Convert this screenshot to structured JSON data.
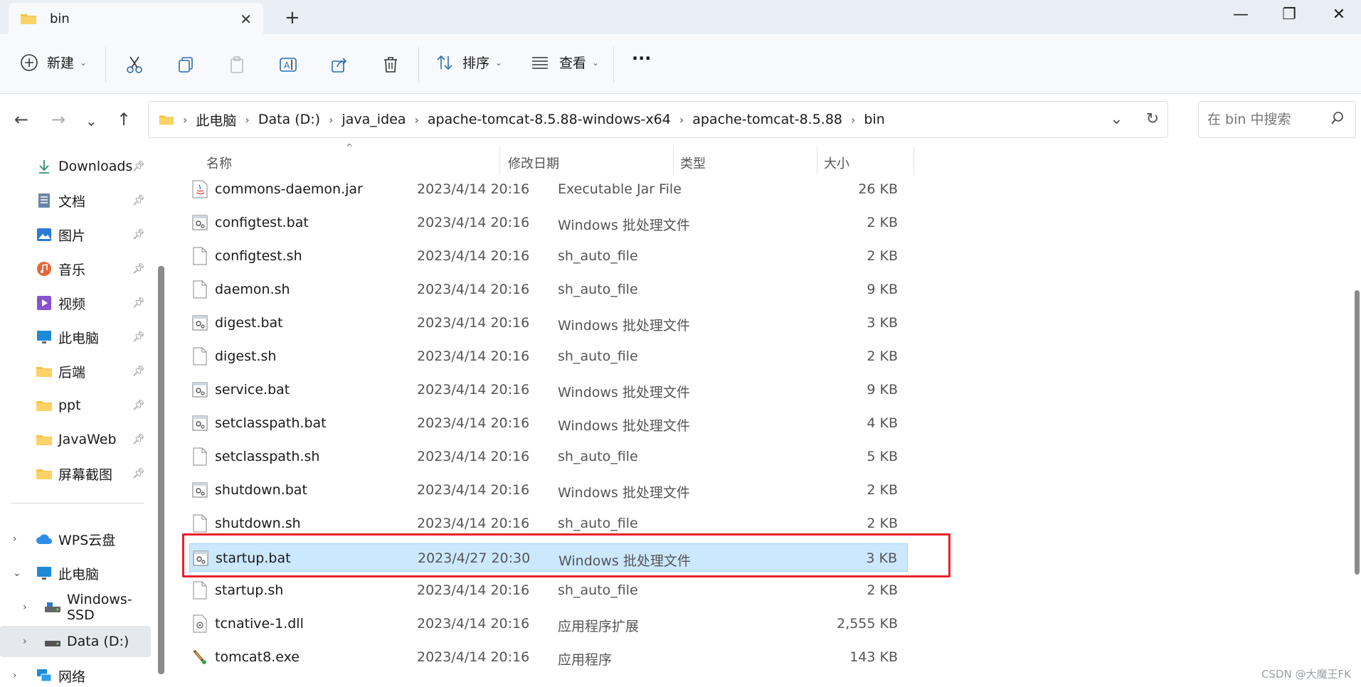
{
  "window": {
    "tab_title": "bin",
    "new_tab": "+",
    "minimize": "—",
    "maximize": "❐",
    "close": "✕",
    "tab_close": "✕"
  },
  "toolbar": {
    "new_label": "新建",
    "sort_label": "排序",
    "view_label": "查看",
    "more": "···",
    "icons": [
      "cut-icon",
      "copy-icon",
      "paste-icon",
      "rename-icon",
      "share-icon",
      "delete-icon"
    ]
  },
  "address": {
    "breadcrumbs": [
      "此电脑",
      "Data (D:)",
      "java_idea",
      "apache-tomcat-8.5.88-windows-x64",
      "apache-tomcat-8.5.88",
      "bin"
    ],
    "search_placeholder": "在 bin 中搜索"
  },
  "sidebar": {
    "items": [
      {
        "label": "Downloads",
        "icon": "download-icon",
        "pinned": true
      },
      {
        "label": "文档",
        "icon": "document-icon",
        "pinned": true
      },
      {
        "label": "图片",
        "icon": "pictures-icon",
        "pinned": true
      },
      {
        "label": "音乐",
        "icon": "music-icon",
        "pinned": true
      },
      {
        "label": "视频",
        "icon": "video-icon",
        "pinned": true
      },
      {
        "label": "此电脑",
        "icon": "computer-icon",
        "pinned": true
      },
      {
        "label": "后端",
        "icon": "folder-icon",
        "pinned": true
      },
      {
        "label": "ppt",
        "icon": "folder-icon",
        "pinned": true
      },
      {
        "label": "JavaWeb",
        "icon": "folder-icon",
        "pinned": true
      },
      {
        "label": "屏幕截图",
        "icon": "folder-icon",
        "pinned": true
      }
    ],
    "tree": [
      {
        "label": "WPS云盘",
        "icon": "cloud-icon",
        "expander": "›"
      },
      {
        "label": "此电脑",
        "icon": "computer-icon",
        "expander": "⌄"
      },
      {
        "label": "Windows-SSD",
        "icon": "drive-icon",
        "expander": "›"
      },
      {
        "label": "Data (D:)",
        "icon": "drive-icon",
        "expander": "›"
      },
      {
        "label": "网络",
        "icon": "network-icon",
        "expander": "›"
      }
    ]
  },
  "list": {
    "columns": {
      "name": "名称",
      "date": "修改日期",
      "type": "类型",
      "size": "大小"
    },
    "rows": [
      {
        "name": "commons-daemon.jar",
        "date": "2023/4/14 20:16",
        "type": "Executable Jar File",
        "size": "26 KB",
        "icon": "jar-icon"
      },
      {
        "name": "configtest.bat",
        "date": "2023/4/14 20:16",
        "type": "Windows 批处理文件",
        "size": "2 KB",
        "icon": "bat-icon"
      },
      {
        "name": "configtest.sh",
        "date": "2023/4/14 20:16",
        "type": "sh_auto_file",
        "size": "2 KB",
        "icon": "file-icon"
      },
      {
        "name": "daemon.sh",
        "date": "2023/4/14 20:16",
        "type": "sh_auto_file",
        "size": "9 KB",
        "icon": "file-icon"
      },
      {
        "name": "digest.bat",
        "date": "2023/4/14 20:16",
        "type": "Windows 批处理文件",
        "size": "3 KB",
        "icon": "bat-icon"
      },
      {
        "name": "digest.sh",
        "date": "2023/4/14 20:16",
        "type": "sh_auto_file",
        "size": "2 KB",
        "icon": "file-icon"
      },
      {
        "name": "service.bat",
        "date": "2023/4/14 20:16",
        "type": "Windows 批处理文件",
        "size": "9 KB",
        "icon": "bat-icon"
      },
      {
        "name": "setclasspath.bat",
        "date": "2023/4/14 20:16",
        "type": "Windows 批处理文件",
        "size": "4 KB",
        "icon": "bat-icon"
      },
      {
        "name": "setclasspath.sh",
        "date": "2023/4/14 20:16",
        "type": "sh_auto_file",
        "size": "5 KB",
        "icon": "file-icon"
      },
      {
        "name": "shutdown.bat",
        "date": "2023/4/14 20:16",
        "type": "Windows 批处理文件",
        "size": "2 KB",
        "icon": "bat-icon"
      },
      {
        "name": "shutdown.sh",
        "date": "2023/4/14 20:16",
        "type": "sh_auto_file",
        "size": "2 KB",
        "icon": "file-icon"
      },
      {
        "name": "startup.bat",
        "date": "2023/4/27 20:30",
        "type": "Windows 批处理文件",
        "size": "3 KB",
        "icon": "bat-icon",
        "selected": true
      },
      {
        "name": "startup.sh",
        "date": "2023/4/14 20:16",
        "type": "sh_auto_file",
        "size": "2 KB",
        "icon": "file-icon"
      },
      {
        "name": "tcnative-1.dll",
        "date": "2023/4/14 20:16",
        "type": "应用程序扩展",
        "size": "2,555 KB",
        "icon": "dll-icon"
      },
      {
        "name": "tomcat8.exe",
        "date": "2023/4/14 20:16",
        "type": "应用程序",
        "size": "143 KB",
        "icon": "exe-icon"
      }
    ]
  },
  "colors": {
    "selection": "#cce8ff",
    "highlight_border": "#e8202a",
    "folder": "#f6c343"
  },
  "watermark": "CSDN @大魔王FK"
}
